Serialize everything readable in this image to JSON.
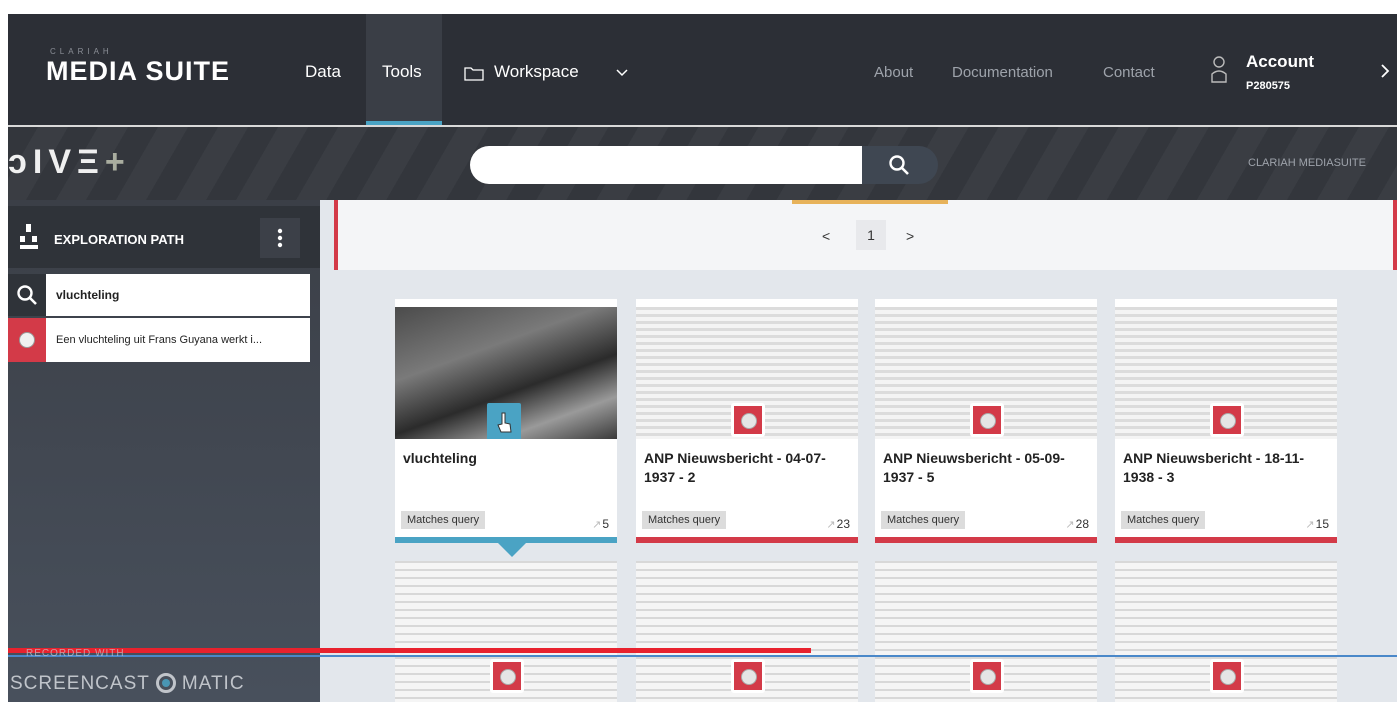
{
  "nav": {
    "brand_small": "CLARIAH",
    "brand": "MEDIA SUITE",
    "items": [
      "Data",
      "Tools"
    ],
    "workspace": "Workspace",
    "right": [
      "About",
      "Documentation",
      "Contact"
    ],
    "account_label": "Account",
    "account_id": "P280575"
  },
  "dive": {
    "logo": "ↄIVΞ",
    "plus": "+",
    "search_placeholder": "",
    "brand_right": "CLARIAH MEDIASUITE"
  },
  "sidebar": {
    "title": "EXPLORATION PATH",
    "query": "vluchteling",
    "item": "Een vluchteling uit Frans Guyana werkt i..."
  },
  "pager": {
    "prev": "<",
    "page": "1",
    "next": ">"
  },
  "cards": [
    {
      "title": "vluchteling",
      "tag": "Matches query",
      "count": "5"
    },
    {
      "title": "ANP Nieuwsbericht - 04-07-1937 - 2",
      "tag": "Matches query",
      "count": "23"
    },
    {
      "title": "ANP Nieuwsbericht - 05-09-1937 - 5",
      "tag": "Matches query",
      "count": "28"
    },
    {
      "title": "ANP Nieuwsbericht - 18-11-1938 - 3",
      "tag": "Matches query",
      "count": "15"
    }
  ],
  "watermark": {
    "small": "RECORDED WITH",
    "left": "SCREENCAST",
    "right": "MATIC"
  },
  "colors": {
    "nav_bg": "#2c2f36",
    "accent_red": "#d33a48",
    "accent_blue": "#4aa3c4",
    "accent_gold": "#e7b25a"
  }
}
